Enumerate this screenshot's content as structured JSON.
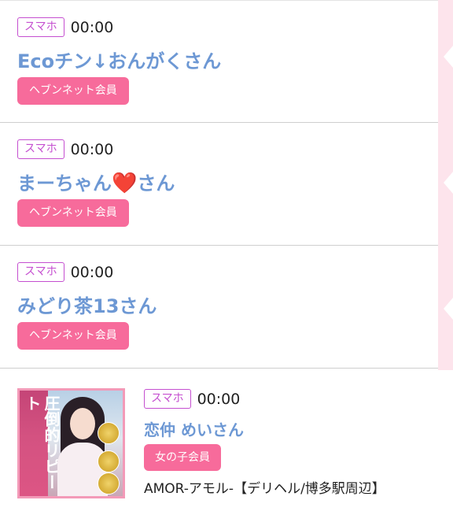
{
  "entries": [
    {
      "device": "スマホ",
      "time": "00:00",
      "name": "Ecoチン↓おんがくさん",
      "member": "ヘブンネット会員"
    },
    {
      "device": "スマホ",
      "time": "00:00",
      "name_before": "まーちゃん",
      "heart": "❤️",
      "name_after": "さん",
      "member": "ヘブンネット会員"
    },
    {
      "device": "スマホ",
      "time": "00:00",
      "name": "みどり茶13さん",
      "member": "ヘブンネット会員"
    }
  ],
  "last": {
    "device": "スマホ",
    "time": "00:00",
    "name": "恋仲 めいさん",
    "member": "女の子会員",
    "shop": "AMOR-アモル-【デリヘル/博多駅周辺】",
    "thumb_text": "圧倒的リピート"
  },
  "colors": {
    "name": "#6d98d4",
    "badge_border": "#c54fd0",
    "member_bg": "#f76b9b",
    "strip": "#fde4ec"
  }
}
